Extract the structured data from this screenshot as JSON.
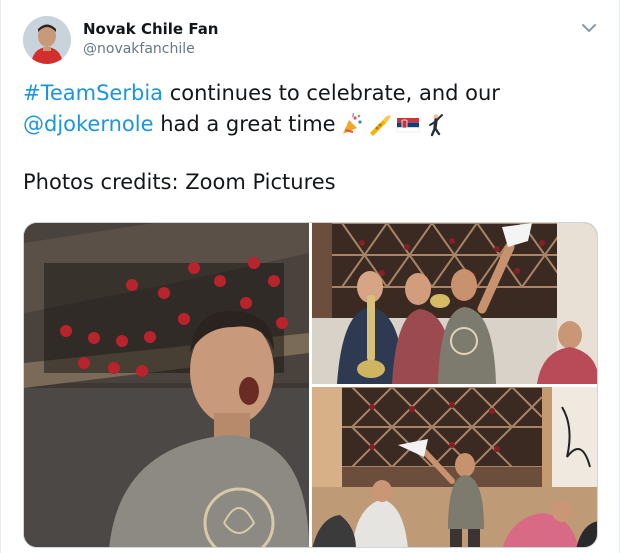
{
  "tweet": {
    "author_name": "Novak Chile Fan",
    "author_handle": "@novakfanchile",
    "text": {
      "hashtag": "#TeamSerbia",
      "line1_rest": " continues to celebrate, and our",
      "mention": "@djokernole",
      "line2_rest": " had a great time",
      "emojis": [
        "party-popper-icon",
        "trumpet-icon",
        "serbia-flag-icon",
        "dancing-man-icon"
      ],
      "credits": "Photos credits: Zoom Pictures"
    },
    "media": {
      "photos": [
        {
          "name": "photo-singing"
        },
        {
          "name": "photo-trumpet"
        },
        {
          "name": "photo-celebration"
        }
      ]
    }
  },
  "colors": {
    "link": "#1b95e0",
    "text": "#14171a",
    "secondary": "#657786",
    "border": "#ccd6dd"
  }
}
